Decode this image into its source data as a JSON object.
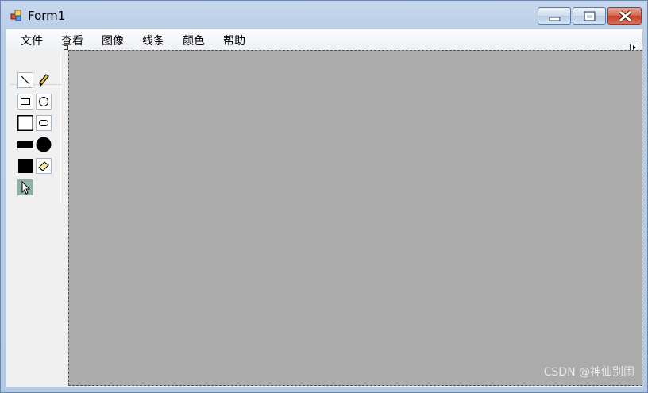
{
  "window": {
    "title": "Form1"
  },
  "menu": {
    "items": [
      "文件",
      "查看",
      "图像",
      "线条",
      "颜色",
      "帮助"
    ]
  },
  "tools": [
    {
      "name": "line-tool",
      "icon": "diagonal-line-icon"
    },
    {
      "name": "pencil-tool",
      "icon": "pencil-icon"
    },
    {
      "name": "rectangle-tool",
      "icon": "rectangle-outline-icon"
    },
    {
      "name": "ellipse-tool",
      "icon": "circle-outline-icon"
    },
    {
      "name": "square-outline-tool",
      "icon": "square-outline-icon"
    },
    {
      "name": "rounded-rect-tool",
      "icon": "rounded-rect-icon"
    },
    {
      "name": "filled-rect-tool",
      "icon": "filled-rect-icon"
    },
    {
      "name": "filled-circle-tool",
      "icon": "filled-circle-icon"
    },
    {
      "name": "filled-square-tool",
      "icon": "filled-square-icon"
    },
    {
      "name": "eraser-tool",
      "icon": "eraser-icon"
    },
    {
      "name": "pointer-tool",
      "icon": "arrow-cursor-icon"
    }
  ],
  "canvas": {
    "background": "#ababab"
  },
  "watermark": "CSDN @神仙别闹"
}
